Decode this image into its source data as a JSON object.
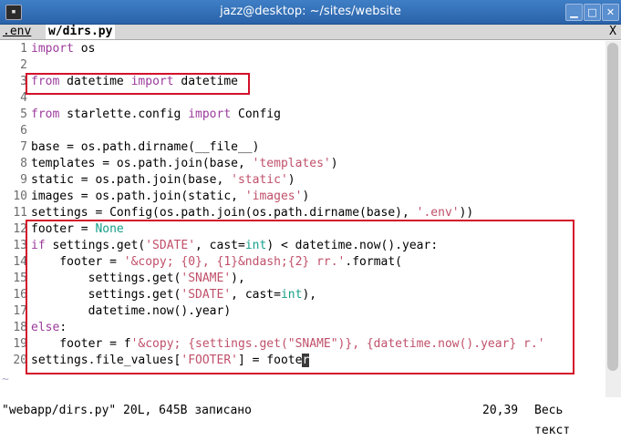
{
  "window": {
    "title": "jazz@desktop: ~/sites/website"
  },
  "tabs": [
    {
      "label": ".env"
    },
    {
      "label": "w/dirs.py"
    }
  ],
  "tab_close": "X",
  "code": [
    {
      "n": "1"
    },
    {
      "n": "2"
    },
    {
      "n": "3"
    },
    {
      "n": "4"
    },
    {
      "n": "5"
    },
    {
      "n": "6"
    },
    {
      "n": "7"
    },
    {
      "n": "8"
    },
    {
      "n": "9"
    },
    {
      "n": "10"
    },
    {
      "n": "11"
    },
    {
      "n": "12"
    },
    {
      "n": "13"
    },
    {
      "n": "14"
    },
    {
      "n": "15"
    },
    {
      "n": "16"
    },
    {
      "n": "17"
    },
    {
      "n": "18"
    },
    {
      "n": "19"
    },
    {
      "n": "20"
    }
  ],
  "tokens": {
    "import": "import",
    "from": "from",
    "os": " os",
    "datetime_mod": " datetime ",
    "datetime_cls": " datetime",
    "starlette": " starlette.config ",
    "config": " Config",
    "l7": "base = os.path.dirname(__file__)",
    "l8a": "templates = os.path.join(base, ",
    "l8s": "'templates'",
    "l9a": "static = os.path.join(base, ",
    "l9s": "'static'",
    "l10a": "images = os.path.join(static, ",
    "l10s": "'images'",
    "l11a": "settings = Config(os.path.join(os.path.dirname(base), ",
    "l11s": "'.env'",
    "l11b": "))",
    "l12a": "footer = ",
    "l12b": "None",
    "if": "if",
    "l13a": " settings.get(",
    "l13s": "'SDATE'",
    "l13b": ", cast=",
    "l13c": "int",
    "l13d": ") < datetime.now().year:",
    "l14a": "    footer = ",
    "l14s": "'&copy; {0}, {1}&ndash;{2} rr.'",
    "l14b": ".format(",
    "l15a": "        settings.get(",
    "l15s": "'SNAME'",
    "l15b": "),",
    "l16a": "        settings.get(",
    "l16s": "'SDATE'",
    "l16b": ", cast=",
    "l16c": "int",
    "l16d": "),",
    "l17": "        datetime.now().year)",
    "else": "else",
    "colon": ":",
    "l19a": "    footer = f",
    "l19s": "'&copy; {settings.get(\"SNAME\")}, {datetime.now().year} r.'",
    "l20a": "settings.file_values[",
    "l20s": "'FOOTER'",
    "l20b": "] = foote",
    "l20c": "r",
    "tilde": "~"
  },
  "status": {
    "message": "\"webapp/dirs.py\" 20L, 645B записано",
    "position": "20,39",
    "scroll": "Весь текст"
  }
}
